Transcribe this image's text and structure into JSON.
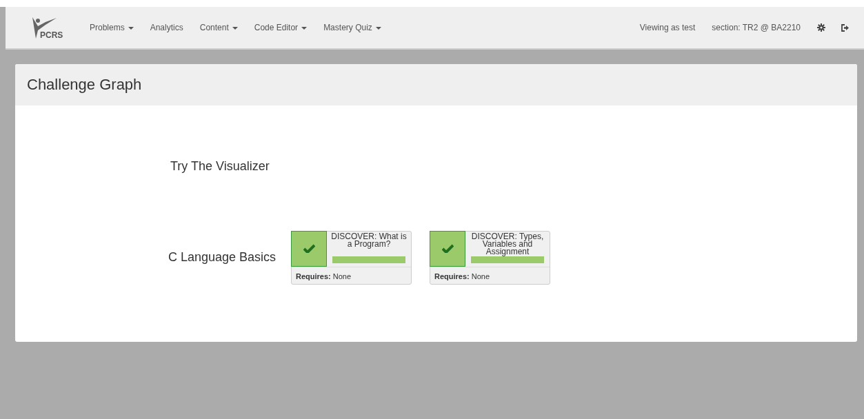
{
  "navbar": {
    "brand": "PCRS",
    "menu": [
      {
        "label": "Problems",
        "dropdown": true
      },
      {
        "label": "Analytics",
        "dropdown": false
      },
      {
        "label": "Content",
        "dropdown": true
      },
      {
        "label": "Code Editor",
        "dropdown": true
      },
      {
        "label": "Mastery Quiz",
        "dropdown": true
      }
    ],
    "viewing": "Viewing as test",
    "section": "section: TR2 @ BA2210"
  },
  "panel": {
    "title": "Challenge Graph",
    "rows": [
      {
        "label": "Try The Visualizer",
        "challenges": []
      },
      {
        "label": "C Language Basics",
        "challenges": [
          {
            "title": "DISCOVER: What is a Program?",
            "completed": true,
            "level": 1,
            "requires": "**Requires:** None"
          },
          {
            "title": "DISCOVER: Types, Variables and Assignment",
            "completed": true,
            "level": 1,
            "requires": "**Requires:** None"
          }
        ]
      }
    ]
  }
}
